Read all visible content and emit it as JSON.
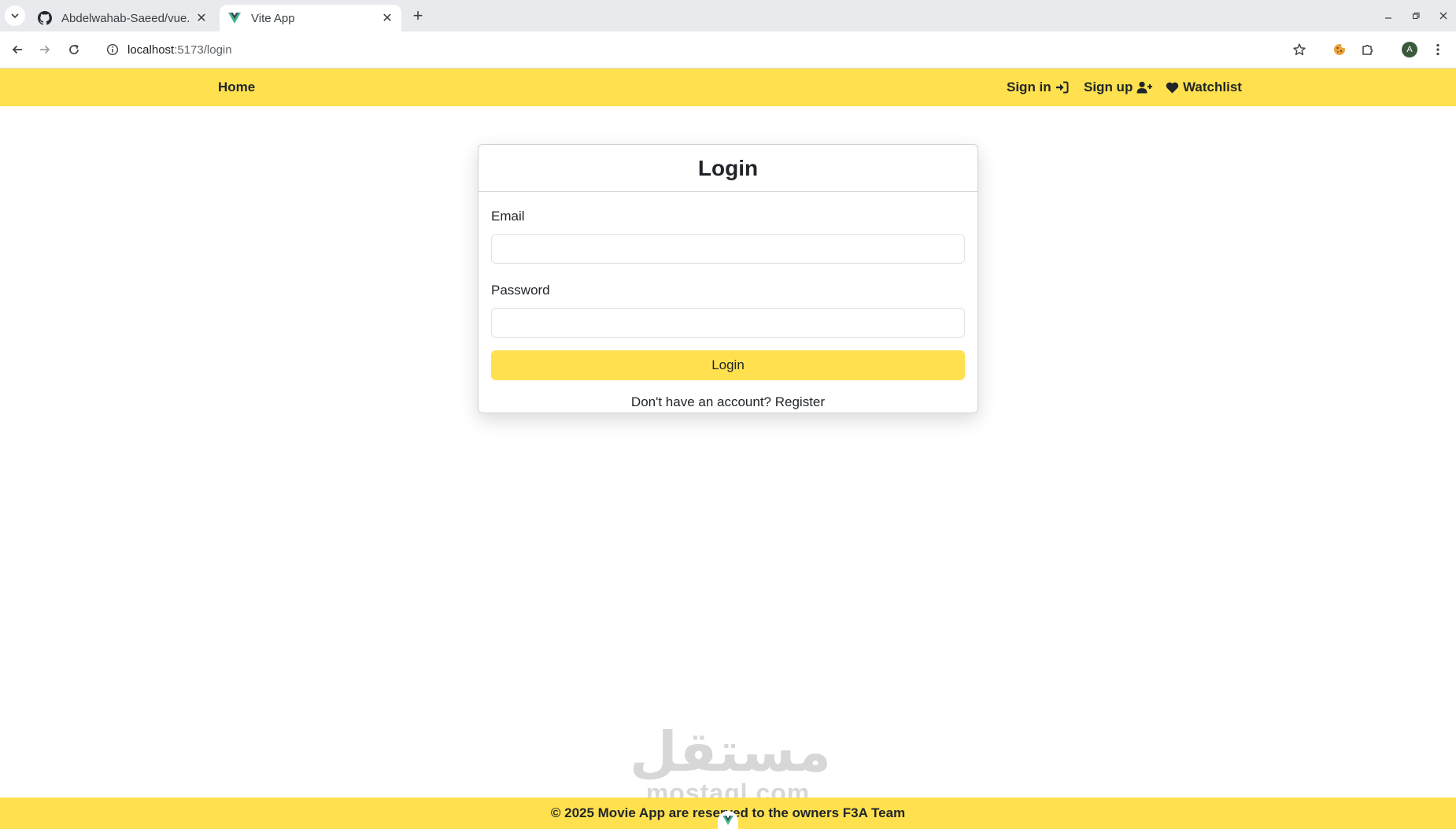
{
  "browser": {
    "tabs": [
      {
        "title": "Abdelwahab-Saeed/vue.",
        "favicon": "github-icon",
        "active": false
      },
      {
        "title": "Vite App",
        "favicon": "vue-icon",
        "active": true
      }
    ],
    "url_host": "localhost",
    "url_rest": ":5173/login"
  },
  "navbar": {
    "home": "Home",
    "sign_in": "Sign in",
    "sign_up": "Sign up",
    "watchlist": "Watchlist"
  },
  "login": {
    "title": "Login",
    "email_label": "Email",
    "email_value": "",
    "password_label": "Password",
    "password_value": "",
    "submit_label": "Login",
    "no_account_text": "Don't have an account?",
    "register_link": "Register"
  },
  "watermark": {
    "arabic": "مستقل",
    "latin": "mostaql.com"
  },
  "footer": {
    "text": "© 2025 Movie App are reserved to the owners F3A Team"
  },
  "colors": {
    "brand_yellow": "#ffe14f",
    "text_dark": "#212529"
  }
}
